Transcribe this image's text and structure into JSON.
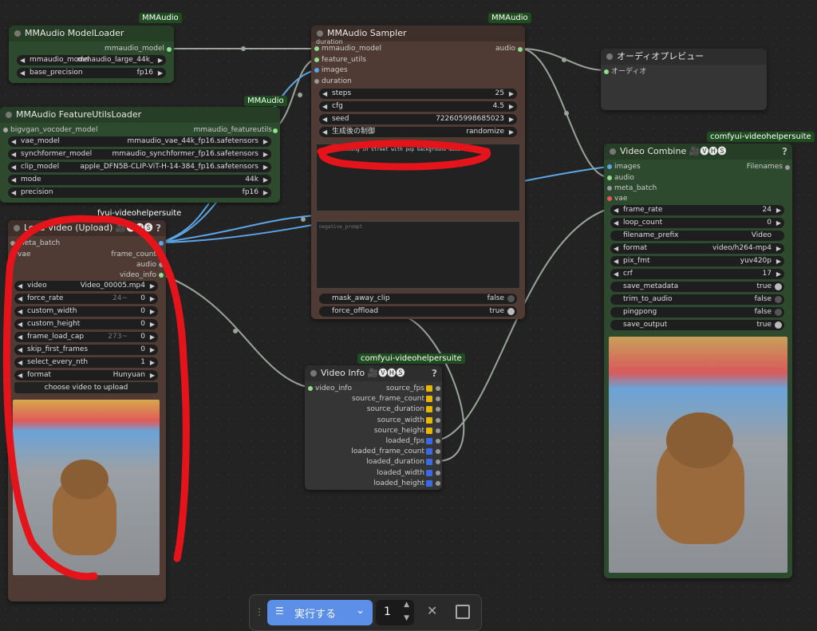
{
  "top_labels": {
    "mmaudio_a": "MMAudio",
    "mmaudio_b": "MMAudio",
    "mmaudio_c": "MMAudio",
    "vhs_a": "comfyui-videohelpersuite",
    "vhs_b": "comfyui-videohelpersuite",
    "vhs_c": "fyui-videohelpersuite"
  },
  "model_loader": {
    "title": "MMAudio ModelLoader",
    "output": "mmaudio_model",
    "widgets": [
      {
        "label": "mmaudio_model",
        "value": "mmaudio_large_44k_v..."
      },
      {
        "label": "base_precision",
        "value": "fp16"
      }
    ]
  },
  "feature_loader": {
    "title": "MMAudio FeatureUtilsLoader",
    "input": "bigvgan_vocoder_model",
    "output": "mmaudio_featureutils",
    "widgets": [
      {
        "label": "vae_model",
        "value": "mmaudio_vae_44k_fp16.safetensors"
      },
      {
        "label": "synchformer_model",
        "value": "mmaudio_synchformer_fp16.safetensors"
      },
      {
        "label": "clip_model",
        "value": "apple_DFN5B-CLIP-ViT-H-14-384_fp16.safetensors"
      },
      {
        "label": "mode",
        "value": "44k"
      },
      {
        "label": "precision",
        "value": "fp16"
      }
    ]
  },
  "sampler": {
    "title": "MMAudio Sampler",
    "duration_top": "duration",
    "inputs": [
      "mmaudio_model",
      "feature_utils",
      "images",
      "duration"
    ],
    "output": "audio",
    "widgets": [
      {
        "label": "steps",
        "value": "25"
      },
      {
        "label": "cfg",
        "value": "4.5"
      },
      {
        "label": "seed",
        "value": "722605998685023"
      },
      {
        "label": "生成後の制御",
        "value": "randomize"
      }
    ],
    "prompt": "cat is walking in street with pop background music.",
    "negative_placeholder": "negative_prompt",
    "toggles": [
      {
        "label": "mask_away_clip",
        "value": "false"
      },
      {
        "label": "force_offload",
        "value": "true"
      }
    ]
  },
  "audio_preview": {
    "title": "オーディオプレビュー",
    "input": "オーディオ"
  },
  "load_video": {
    "title": "Load Video (Upload) 🎥🅥🅗🅢",
    "inputs": [
      "meta_batch",
      "vae"
    ],
    "outputs": [
      "frame_count",
      "audio",
      "video_info"
    ],
    "widgets": [
      {
        "label": "video",
        "value": "Video_00005.mp4",
        "hint": ""
      },
      {
        "label": "force_rate",
        "value": "0",
        "hint": "24~"
      },
      {
        "label": "custom_width",
        "value": "0",
        "hint": ""
      },
      {
        "label": "custom_height",
        "value": "0",
        "hint": ""
      },
      {
        "label": "frame_load_cap",
        "value": "0",
        "hint": "273~"
      },
      {
        "label": "skip_first_frames",
        "value": "0",
        "hint": ""
      },
      {
        "label": "select_every_nth",
        "value": "1",
        "hint": ""
      },
      {
        "label": "format",
        "value": "Hunyuan",
        "hint": ""
      }
    ],
    "upload_btn": "choose video to upload",
    "help": "?"
  },
  "video_info": {
    "title": "Video Info 🎥🅥🅗🅢",
    "input": "video_info",
    "help": "?",
    "outputs": [
      {
        "label": "source_fps",
        "color": "#e6b800"
      },
      {
        "label": "source_frame_count",
        "color": "#e6b800"
      },
      {
        "label": "source_duration",
        "color": "#e6b800"
      },
      {
        "label": "source_width",
        "color": "#e6b800"
      },
      {
        "label": "source_height",
        "color": "#e6b800"
      },
      {
        "label": "loaded_fps",
        "color": "#3a6ae6"
      },
      {
        "label": "loaded_frame_count",
        "color": "#3a6ae6"
      },
      {
        "label": "loaded_duration",
        "color": "#3a6ae6"
      },
      {
        "label": "loaded_width",
        "color": "#3a6ae6"
      },
      {
        "label": "loaded_height",
        "color": "#3a6ae6"
      }
    ]
  },
  "video_combine": {
    "title": "Video Combine 🎥🅥🅗🅢",
    "inputs": [
      "images",
      "audio",
      "meta_batch",
      "vae"
    ],
    "output": "Filenames",
    "help": "?",
    "widgets": [
      {
        "label": "frame_rate",
        "value": "24",
        "arrows": true
      },
      {
        "label": "loop_count",
        "value": "0",
        "arrows": true
      },
      {
        "label": "filename_prefix",
        "value": "Video",
        "arrows": false
      },
      {
        "label": "format",
        "value": "video/h264-mp4",
        "arrows": true
      },
      {
        "label": "pix_fmt",
        "value": "yuv420p",
        "arrows": true
      },
      {
        "label": "crf",
        "value": "17",
        "arrows": true
      },
      {
        "label": "save_metadata",
        "value": "true",
        "toggle": true
      },
      {
        "label": "trim_to_audio",
        "value": "false",
        "toggle": true
      },
      {
        "label": "pingpong",
        "value": "false",
        "toggle": true
      },
      {
        "label": "save_output",
        "value": "true",
        "toggle": true
      }
    ]
  },
  "toolbar": {
    "run_label": "実行する",
    "count": "1"
  },
  "colors": {
    "link_blue": "#5aa6e6",
    "link_gray": "#9aa59a",
    "annotation_red": "#e5141b"
  }
}
